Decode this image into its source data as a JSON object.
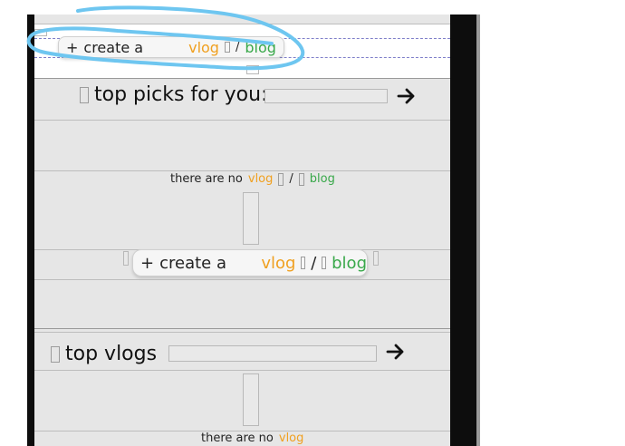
{
  "create_bar": {
    "plus": "+",
    "create_label": "create a",
    "vlog": "vlog",
    "separator": "/",
    "blog": "blog"
  },
  "top_picks": {
    "title": "top picks for you:",
    "arrow": "→",
    "input_value": ""
  },
  "empty_state_1": {
    "text": "there are no",
    "vlog": "vlog",
    "separator": "/",
    "blog": "blog"
  },
  "create_button": {
    "plus": "+",
    "create_label": "create a",
    "vlog": "vlog",
    "separator": "/",
    "blog": "blog"
  },
  "top_vlogs": {
    "title": "top vlogs",
    "arrow": "→",
    "input_value": ""
  },
  "empty_state_2": {
    "text": "there are no",
    "vlog": "vlog"
  },
  "colors": {
    "vlog": "#f0a020",
    "blog": "#39a84a",
    "annotation": "#6ec6f0"
  },
  "icons": {
    "arrow": "arrow-right-icon",
    "missing_glyph": "missing-glyph-icon",
    "plus": "plus-icon"
  }
}
